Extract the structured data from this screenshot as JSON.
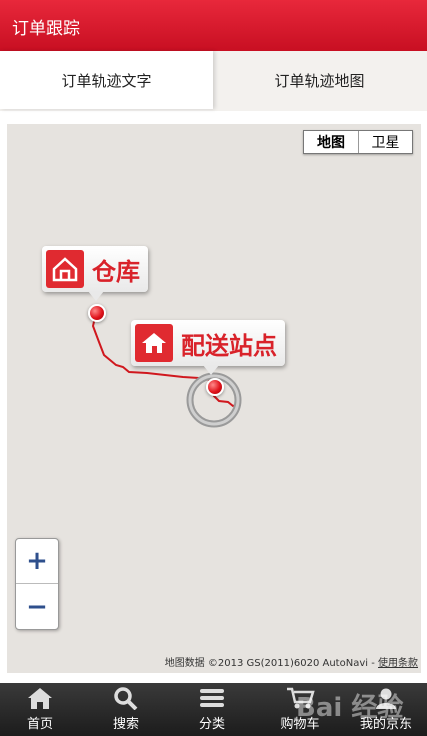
{
  "header": {
    "title": "订单跟踪"
  },
  "tabs": [
    {
      "label": "订单轨迹文字",
      "active": true
    },
    {
      "label": "订单轨迹地图",
      "active": false
    }
  ],
  "map": {
    "map_type": {
      "map": "地图",
      "satellite": "卫星"
    },
    "markers": [
      {
        "label": "仓库",
        "icon": "warehouse-icon"
      },
      {
        "label": "配送站点",
        "icon": "home-icon"
      }
    ],
    "zoom": {
      "in": "+",
      "out": "−"
    },
    "attribution": "地图数据 ©2013 GS(2011)6020 AutoNavi - ",
    "terms": "使用条款",
    "route_color": "#d0181e"
  },
  "bottom_nav": [
    {
      "label": "首页",
      "icon": "home-icon"
    },
    {
      "label": "搜索",
      "icon": "search-icon"
    },
    {
      "label": "分类",
      "icon": "list-icon"
    },
    {
      "label": "购物车",
      "icon": "cart-icon"
    },
    {
      "label": "我的京东",
      "icon": "user-icon"
    }
  ],
  "watermark": "Bai 经验",
  "colors": {
    "brand": "#d51a2c",
    "accent": "#e02a30"
  }
}
